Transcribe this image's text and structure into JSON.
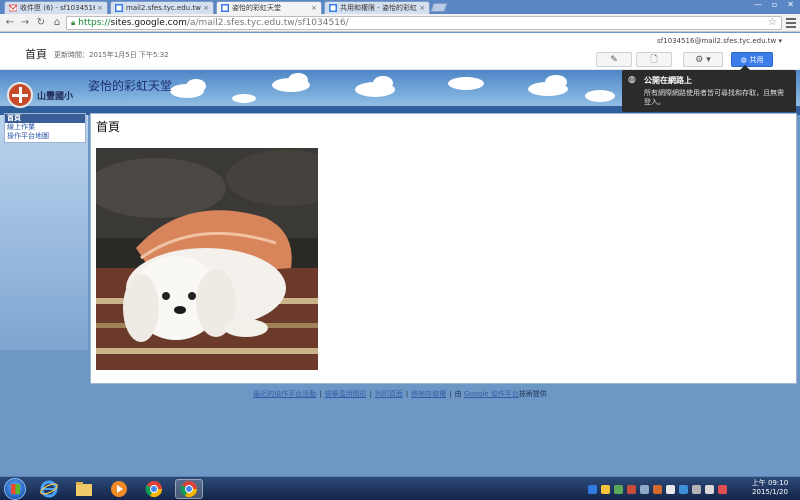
{
  "browser": {
    "tabs": [
      {
        "label": "收件匣 (6) - sf1034516@",
        "icon": "gmail-icon",
        "active": false
      },
      {
        "label": "mail2.sfes.tyc.edu.tw 協作",
        "icon": "sites-icon",
        "active": false
      },
      {
        "label": "姿怡的彩虹天堂",
        "icon": "sites-icon",
        "active": true
      },
      {
        "label": "共用和權限 - 姿怡的彩虹",
        "icon": "sites-icon",
        "active": false
      }
    ],
    "url": {
      "scheme": "https://",
      "host": "sites.google.com",
      "path": "/a/mail2.sfes.tyc.edu.tw/sf1034516/"
    }
  },
  "sites_header": {
    "page_title": "首頁",
    "updated_text": "更新時間：2015年1月5日 下午5:32",
    "account": "sf1034516@mail2.sfes.tyc.edu.tw ▾",
    "share_label": "共用"
  },
  "banner": {
    "school_name": "山豐國小",
    "site_name": "姿怡的彩虹天堂"
  },
  "tooltip": {
    "title": "公開在網路上",
    "body": "所有網際網路使用者皆可尋找和存取，且無需登入。"
  },
  "sidebar": {
    "items": [
      {
        "label": "首頁",
        "current": true
      },
      {
        "label": "線上作業",
        "current": false
      },
      {
        "label": "操作平台地圖",
        "current": false
      }
    ]
  },
  "content": {
    "title": "首頁"
  },
  "footer": {
    "links": [
      "最近的協作平台活動",
      "檢舉濫用情形",
      "列印頁面",
      "移除存取權"
    ],
    "by": "由",
    "google_link": "Google 協作平台",
    "provided": "技術提供"
  },
  "taskbar": {
    "time": "上午 09:10",
    "date": "2015/1/20"
  },
  "colors": {
    "accent": "#3b7de9",
    "banner": "#4f86c7",
    "nav_current": "#3a5f96"
  }
}
